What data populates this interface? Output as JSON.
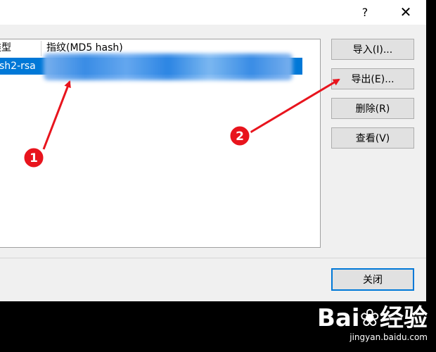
{
  "titlebar": {
    "help_label": "?",
    "close_glyph": "✕"
  },
  "list": {
    "col_type": "类型",
    "col_fingerprint": "指纹(MD5 hash)",
    "rows": [
      {
        "type": "sh2-rsa",
        "fingerprint": ""
      }
    ]
  },
  "buttons": {
    "import_label": "导入(I)...",
    "export_label": "导出(E)...",
    "delete_label": "删除(R)",
    "view_label": "查看(V)",
    "close_label": "关闭"
  },
  "annotations": {
    "marker1": "1",
    "marker2": "2",
    "color": "#e8141d"
  },
  "watermark": {
    "logo": "Bai❀经验",
    "site": "jingyan.baidu.com"
  }
}
